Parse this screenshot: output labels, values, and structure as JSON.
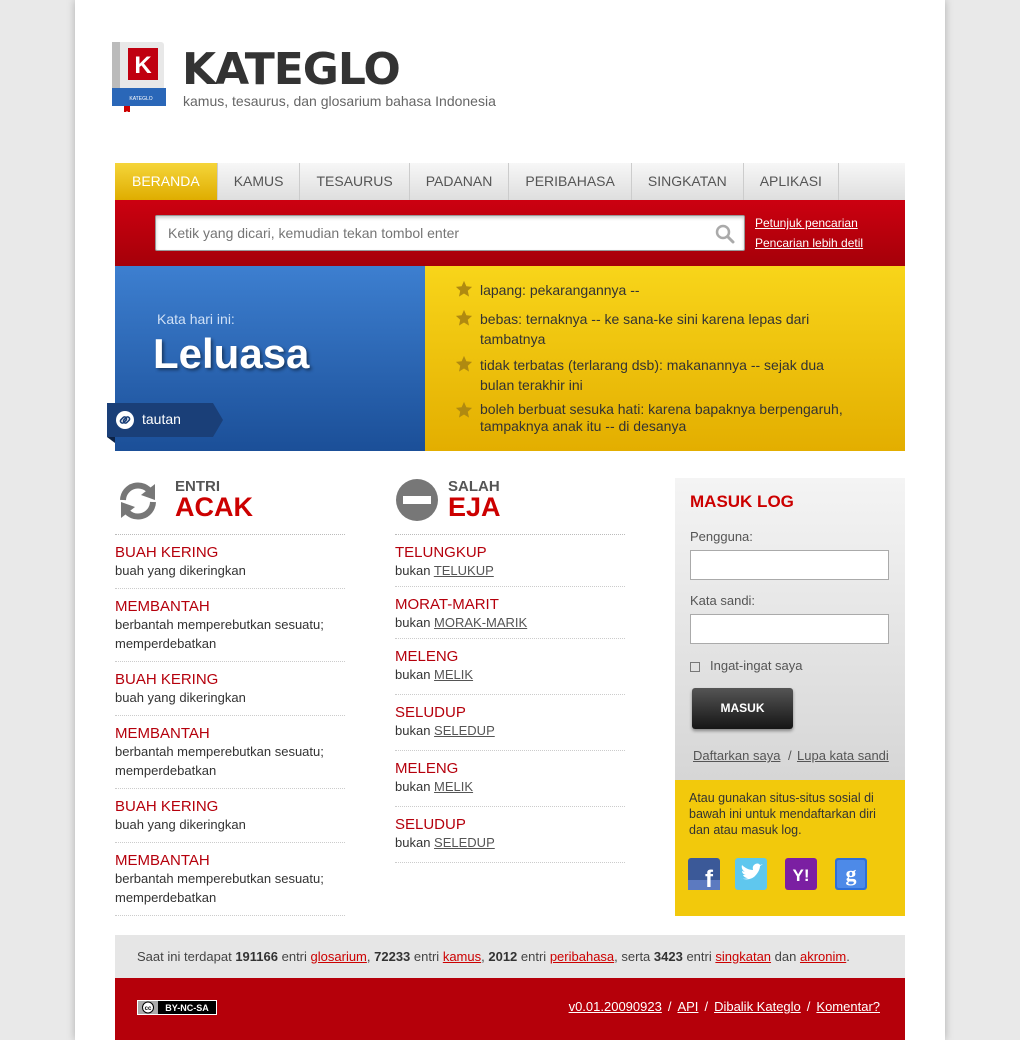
{
  "header": {
    "logo_letter": "K",
    "logo_book_text": "KATEGLO",
    "title": "KATEGLO",
    "tagline": "kamus, tesaurus, dan glosarium bahasa Indonesia"
  },
  "nav": {
    "items": [
      "BERANDA",
      "KAMUS",
      "TESAURUS",
      "PADANAN",
      "PERIBAHASA",
      "SINGKATAN",
      "APLIKASI"
    ]
  },
  "search": {
    "placeholder": "Ketik yang dicari, kemudian tekan tombol enter",
    "link_help": "Petunjuk pencarian",
    "link_advanced": "Pencarian lebih detil"
  },
  "word_of_day": {
    "label": "Kata hari ini:",
    "word": "Leluasa",
    "link_label": "tautan",
    "definitions": [
      "lapang: pekarangannya --",
      "bebas: ternaknya -- ke sana-ke sini karena lepas dari tambatnya",
      "tidak terbatas (terlarang dsb): makanannya -- sejak dua bulan terakhir ini",
      "boleh berbuat sesuka hati: karena bapaknya berpengaruh, tampaknya anak itu -- di desanya"
    ]
  },
  "random": {
    "small": "ENTRI",
    "big": "ACAK",
    "entries": [
      {
        "title": "BUAH KERING",
        "desc": "buah yang dikeringkan"
      },
      {
        "title": "MEMBANTAH",
        "desc": "berbantah memperebutkan sesuatu; memperdebatkan"
      },
      {
        "title": "BUAH KERING",
        "desc": "buah yang dikeringkan"
      },
      {
        "title": "MEMBANTAH",
        "desc": "berbantah memperebutkan sesuatu; memperdebatkan"
      },
      {
        "title": "BUAH KERING",
        "desc": "buah yang dikeringkan"
      },
      {
        "title": "MEMBANTAH",
        "desc": "berbantah memperebutkan sesuatu; memperdebatkan"
      }
    ]
  },
  "misspell": {
    "small": "SALAH",
    "big": "EJA",
    "bukan": "bukan",
    "entries": [
      {
        "title": "TELUNGKUP",
        "wrong": "TELUKUP"
      },
      {
        "title": "MORAT-MARIT",
        "wrong": "MORAK-MARIK"
      },
      {
        "title": "MELENG",
        "wrong": "MELIK"
      },
      {
        "title": "SELUDUP",
        "wrong": "SELEDUP"
      },
      {
        "title": "MELENG",
        "wrong": "MELIK"
      },
      {
        "title": "SELUDUP",
        "wrong": "SELEDUP"
      }
    ]
  },
  "login": {
    "title": "MASUK LOG",
    "user_label": "Pengguna:",
    "pass_label": "Kata sandi:",
    "remember": "Ingat-ingat saya",
    "button": "MASUK",
    "register": "Daftarkan saya",
    "separator": "/",
    "forgot": "Lupa kata sandi",
    "social_text": "Atau gunakan situs-situs sosial di bawah ini untuk mendaftarkan diri dan atau masuk log.",
    "facebook_letter": "f",
    "yahoo_letter": "Y!",
    "google_letter": "g"
  },
  "stats": {
    "prefix": "Saat ini terdapat",
    "n_glosarium": "191166",
    "w_entri": "entri",
    "glosarium": "glosarium",
    "n_kamus": "72233",
    "kamus": "kamus",
    "n_peribahasa": "2012",
    "peribahasa": "peribahasa",
    "serta": ", serta",
    "n_singkatan": "3423",
    "singkatan": "singkatan",
    "dan": "dan",
    "akronim": "akronim"
  },
  "footer": {
    "license": "BY-NC-SA",
    "version": "v0.01.20090923",
    "api": "API",
    "about": "Dibalik Kateglo",
    "comment": "Komentar?",
    "separator": "/"
  },
  "colors": {
    "brand_red": "#c00000",
    "accent_yellow": "#f2c90c",
    "blue": "#2a67b8"
  }
}
